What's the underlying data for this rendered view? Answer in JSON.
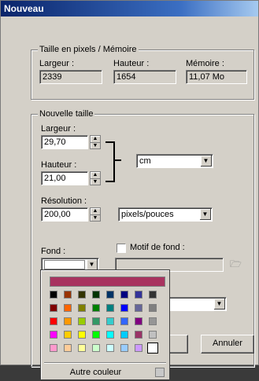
{
  "window": {
    "title": "Nouveau"
  },
  "pixel_size": {
    "group_title": "Taille en pixels / Mémoire",
    "width_label": "Largeur :",
    "width_value": "2339",
    "height_label": "Hauteur :",
    "height_value": "1654",
    "memory_label": "Mémoire :",
    "memory_value": "11,07 Mo"
  },
  "new_size": {
    "group_title": "Nouvelle taille",
    "width_label": "Largeur :",
    "width_value": "29,70",
    "height_label": "Hauteur :",
    "height_value": "21,00",
    "unit": "cm",
    "resolution_label": "Résolution :",
    "resolution_value": "200,00",
    "resolution_unit": "pixels/pouces",
    "background_label": "Fond :",
    "pattern_label": "Motif de fond :",
    "pattern_checked": false
  },
  "buttons": {
    "cancel": "Annuler"
  },
  "color_popup": {
    "current_color": "#a8335f",
    "other_label": "Autre couleur",
    "rows": [
      [
        "#000000",
        "#993300",
        "#333300",
        "#003300",
        "#003366",
        "#000080",
        "#333399",
        "#333333"
      ],
      [
        "#800000",
        "#ff6600",
        "#808000",
        "#008000",
        "#008080",
        "#0000ff",
        "#666699",
        "#808080"
      ],
      [
        "#ff0000",
        "#ff9900",
        "#99cc00",
        "#339966",
        "#33cccc",
        "#3366ff",
        "#800080",
        "#969696"
      ],
      [
        "#ff00ff",
        "#ffcc00",
        "#ffff00",
        "#00ff00",
        "#00ffff",
        "#00ccff",
        "#993366",
        "#c0c0c0"
      ],
      [
        "#ff99cc",
        "#ffcc99",
        "#ffff99",
        "#ccffcc",
        "#ccffff",
        "#99ccff",
        "#cc99ff",
        "#ffffff"
      ]
    ]
  }
}
